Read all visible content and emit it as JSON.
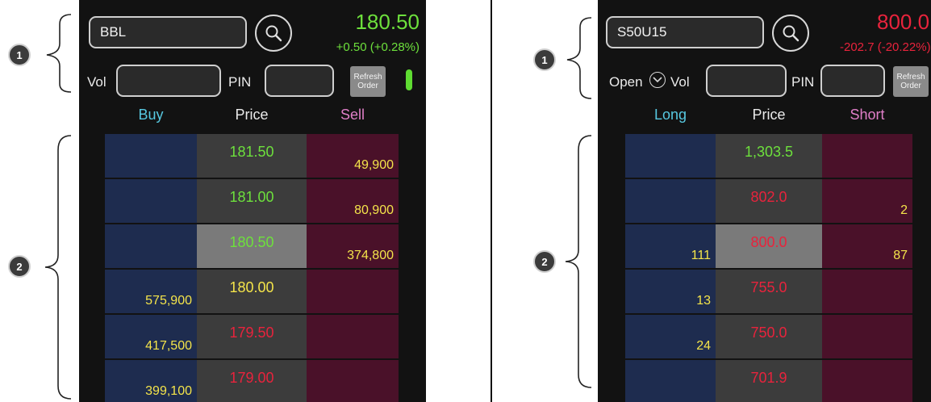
{
  "colors": {
    "green": "#6de03c",
    "red": "#e8233c",
    "yellow": "#f4e44a",
    "buy_header": "#57c8e0",
    "sell_header": "#e07fc8",
    "bid_cell": "#1e2c4f",
    "ask_cell": "#4a1129"
  },
  "left": {
    "badge_header": "1",
    "badge_book": "2",
    "symbol": "BBL",
    "last_price": "180.50",
    "change": "+0.50 (+0.28%)",
    "vol_label": "Vol",
    "pin_label": "PIN",
    "refresh_label": "Refresh Order",
    "col_bid": "Buy",
    "col_price": "Price",
    "col_ask": "Sell",
    "rows": [
      {
        "price": "181.50",
        "price_color": "green",
        "bid": "",
        "ask": "49,900"
      },
      {
        "price": "181.00",
        "price_color": "green",
        "bid": "",
        "ask": "80,900"
      },
      {
        "price": "180.50",
        "price_color": "green",
        "bid": "",
        "ask": "374,800",
        "current": true
      },
      {
        "price": "180.00",
        "price_color": "yellow",
        "bid": "575,900",
        "ask": ""
      },
      {
        "price": "179.50",
        "price_color": "red",
        "bid": "417,500",
        "ask": ""
      },
      {
        "price": "179.00",
        "price_color": "red",
        "bid": "399,100",
        "ask": ""
      }
    ]
  },
  "right": {
    "badge_header": "1",
    "badge_book": "2",
    "symbol": "S50U15",
    "last_price": "800.0",
    "change": "-202.7 (-20.22%)",
    "open_label": "Open",
    "vol_label": "Vol",
    "pin_label": "PIN",
    "refresh_label": "Refresh Order",
    "col_bid": "Long",
    "col_price": "Price",
    "col_ask": "Short",
    "rows": [
      {
        "price": "1,303.5",
        "price_color": "green",
        "bid": "",
        "ask": ""
      },
      {
        "price": "802.0",
        "price_color": "red",
        "bid": "",
        "ask": "2"
      },
      {
        "price": "800.0",
        "price_color": "red",
        "bid": "111",
        "ask": "87",
        "current": true
      },
      {
        "price": "755.0",
        "price_color": "red",
        "bid": "13",
        "ask": ""
      },
      {
        "price": "750.0",
        "price_color": "red",
        "bid": "24",
        "ask": ""
      },
      {
        "price": "701.9",
        "price_color": "red",
        "bid": "",
        "ask": ""
      }
    ]
  }
}
